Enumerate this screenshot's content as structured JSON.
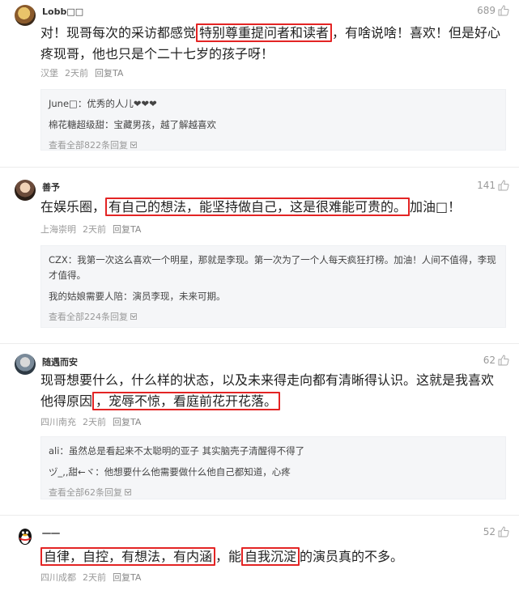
{
  "comments": [
    {
      "username": "Lobb□□",
      "likes": "689",
      "text_before": "对！现哥每次的采访都感觉",
      "highlight_1": "特别尊重提问者和读者",
      "text_after": "，有啥说啥！喜欢！但是好心疼现哥，他也只是个二十七岁的孩子呀！",
      "location": "汉堡",
      "time": "2天前",
      "reply_label": "回复TA",
      "replies": [
        "June□：优秀的人儿❤❤❤",
        "棉花糖超级甜：宝藏男孩，越了解越喜欢"
      ],
      "more": "查看全部822条回复"
    },
    {
      "username": "善予",
      "likes": "141",
      "text_before": "在娱乐圈，",
      "highlight_1": "有自己的想法，能坚持做自己，这是很难能可贵的。",
      "text_after": "加油□！",
      "location": "上海崇明",
      "time": "2天前",
      "reply_label": "回复TA",
      "replies": [
        "CZX：我第一次这么喜欢一个明星，那就是李现。第一次为了一个人每天疯狂打榜。加油！人间不值得，李现才值得。",
        "我的姑娘需要人陪：演员李现，未来可期。"
      ],
      "more": "查看全部224条回复"
    },
    {
      "username": "随遇而安",
      "likes": "62",
      "text_before": "现哥想要什么，什么样的状态，以及未来得走向都有清晰得认识。这就是我喜欢他得原因",
      "highlight_1": "，宠辱不惊，看庭前花开花落。",
      "text_after": "",
      "location": "四川南充",
      "time": "2天前",
      "reply_label": "回复TA",
      "replies": [
        "ali：虽然总是看起来不太聪明的亚子 其实脑壳子清醒得不得了",
        "ヅ_,,甜←ヾ：他想要什么他需要做什么他自己都知道，心疼"
      ],
      "more": "查看全部62条回复"
    },
    {
      "username": "一一",
      "likes": "52",
      "text_before": "",
      "highlight_1": "自律，自控，有想法，有内涵",
      "text_middle": "，能",
      "highlight_2": "自我沉淀",
      "text_after": "的演员真的不多。",
      "location": "四川成都",
      "time": "2天前",
      "reply_label": "回复TA"
    }
  ],
  "colors": {
    "highlight_border": "#e32424",
    "meta_text": "#999999",
    "reply_bg": "#f5f6f8"
  },
  "icons": {
    "like": "thumbs-up-icon",
    "expand": "chevron-down-icon"
  }
}
